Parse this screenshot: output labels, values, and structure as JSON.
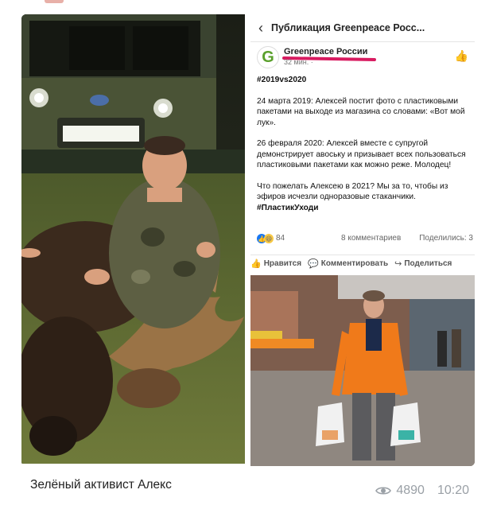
{
  "post": {
    "header_title": "Публикация Greenpeace Росс...",
    "page_name": "Greenpeace России",
    "date": "32 мин. · ",
    "avatar_letter": "G",
    "hashtag_title": "#2019vs2020",
    "paragraph1": "24 марта 2019: Алексей постит фото с пластиковыми пакетами на выходе из магазина со словами: «Вот мой лук».",
    "paragraph2": "26 февраля 2020: Алексей вместе с супругой демонстрирует авоську и призывает всех пользоваться пластиковыми пакетами как можно реже. Молодец!",
    "paragraph3": "Что пожелать Алексею в 2021? Мы за то, чтобы из эфиров исчезли одноразовые стаканчики.",
    "hashtag_end": "#ПластикУходи",
    "reactions_count": "84",
    "comments_count": "8 комментариев",
    "shares_count": "Поделились: 3",
    "action_like": "Нравится",
    "action_comment": "Комментировать",
    "action_share": "Поделиться"
  },
  "message": {
    "caption": "Зелёный активист Алекс",
    "views": "4890",
    "time": "10:20"
  },
  "icons": {
    "back": "chevron-left-icon",
    "like": "thumbs-up-icon",
    "comment": "comment-icon",
    "share": "share-icon",
    "views": "eye-icon"
  },
  "colors": {
    "facebook_blue": "#1877f2",
    "greenpeace_green": "#5aa02c",
    "underline_pink": "#d81b60",
    "jacket_orange": "#f07a1a",
    "meta_gray": "#9aa0a6"
  }
}
